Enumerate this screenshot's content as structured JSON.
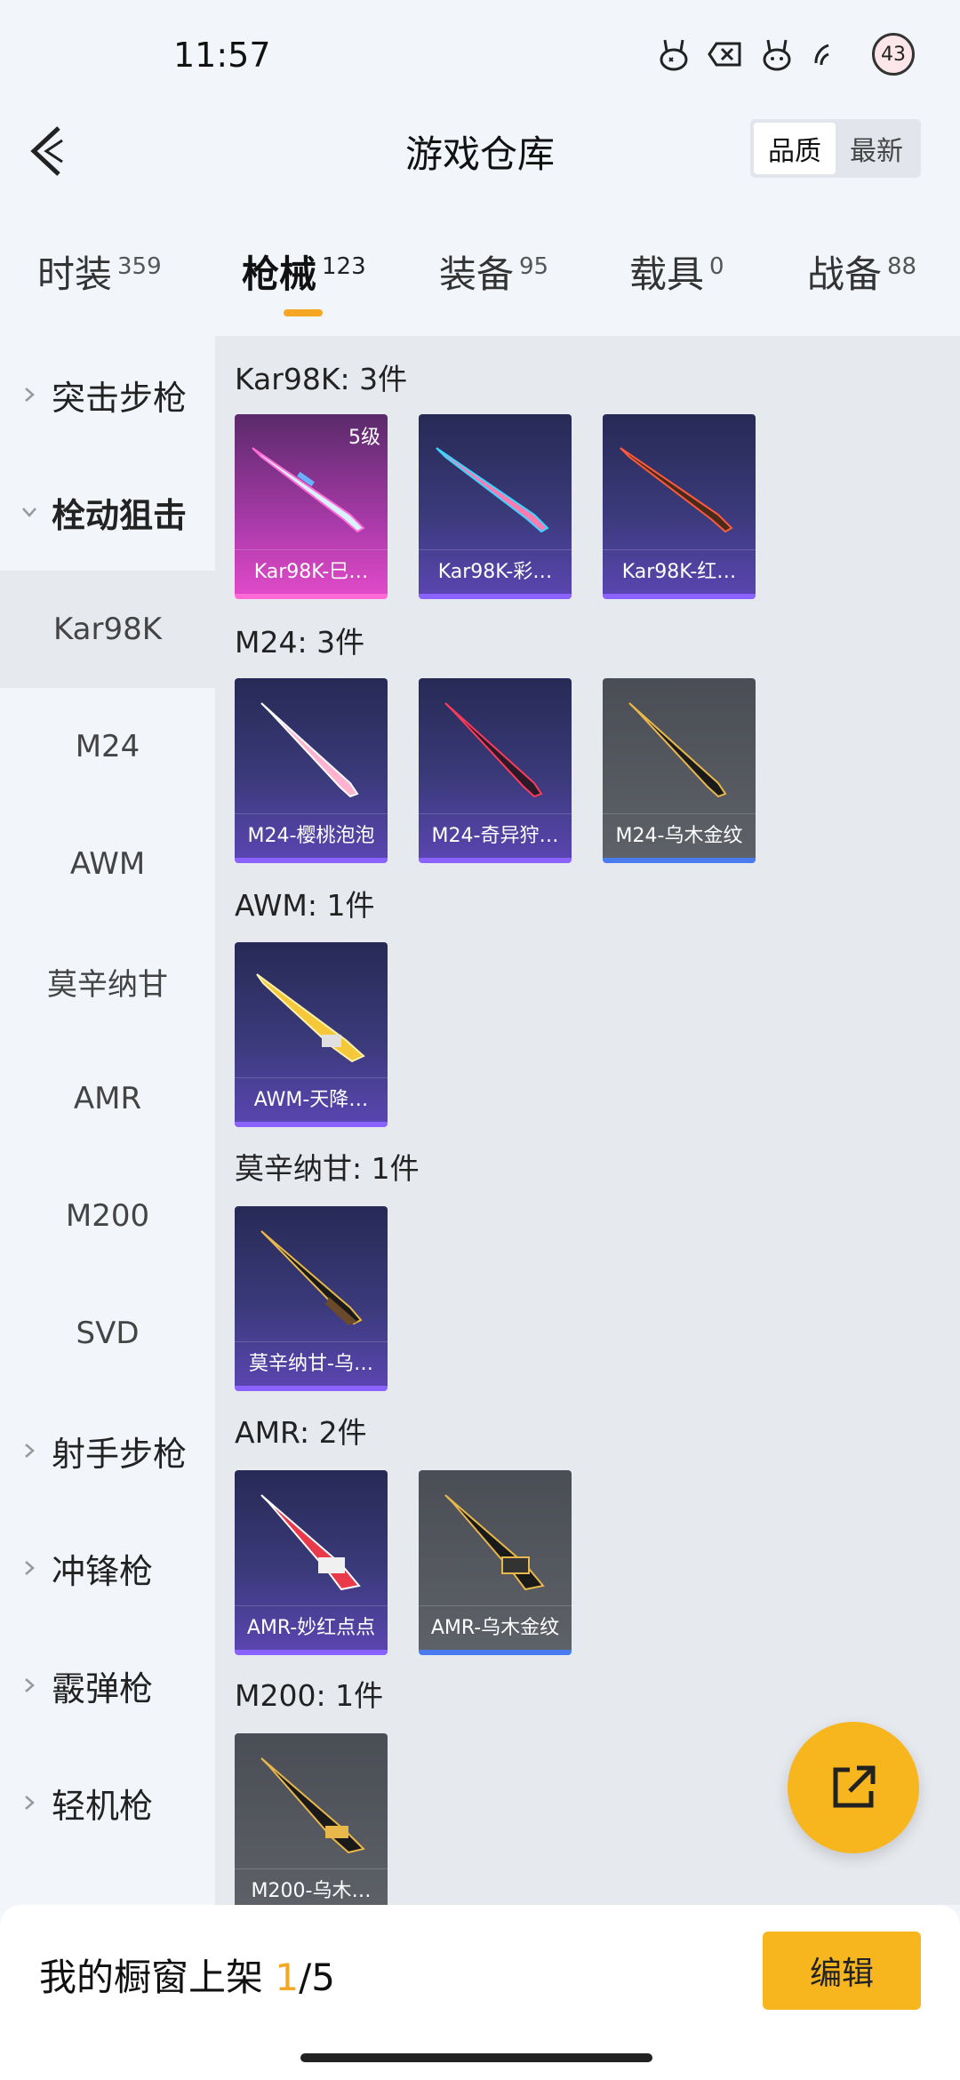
{
  "status_bar": {
    "time": "11:57",
    "notification_count": "43",
    "icons": [
      "rabbit-icon",
      "close-box-icon",
      "rabbit-icon",
      "wifi-icon",
      "avatar-wings-icon"
    ]
  },
  "header": {
    "title": "游戏仓库",
    "sort_options": [
      "品质",
      "最新"
    ],
    "sort_selected": "品质"
  },
  "tabs": [
    {
      "label": "时装",
      "count": "359"
    },
    {
      "label": "枪械",
      "count": "123",
      "active": true
    },
    {
      "label": "装备",
      "count": "95"
    },
    {
      "label": "载具",
      "count": "0"
    },
    {
      "label": "战备",
      "count": "88"
    }
  ],
  "sidebar": [
    {
      "label": "突击步枪",
      "type": "group"
    },
    {
      "label": "栓动狙击",
      "type": "group",
      "expanded": true
    },
    {
      "label": "Kar98K",
      "type": "sub",
      "active": true
    },
    {
      "label": "M24",
      "type": "sub"
    },
    {
      "label": "AWM",
      "type": "sub"
    },
    {
      "label": "莫辛纳甘",
      "type": "sub"
    },
    {
      "label": "AMR",
      "type": "sub"
    },
    {
      "label": "M200",
      "type": "sub"
    },
    {
      "label": "SVD",
      "type": "sub"
    },
    {
      "label": "射手步枪",
      "type": "group"
    },
    {
      "label": "冲锋枪",
      "type": "group"
    },
    {
      "label": "霰弹枪",
      "type": "group"
    },
    {
      "label": "轻机枪",
      "type": "group"
    }
  ],
  "groups": [
    {
      "title": "Kar98K: 3件",
      "items": [
        {
          "name": "Kar98K-巳…",
          "rarity": "pink",
          "level": "5级"
        },
        {
          "name": "Kar98K-彩…",
          "rarity": "purple"
        },
        {
          "name": "Kar98K-红…",
          "rarity": "purple"
        }
      ]
    },
    {
      "title": "M24: 3件",
      "items": [
        {
          "name": "M24-樱桃泡泡",
          "rarity": "purple"
        },
        {
          "name": "M24-奇异狩…",
          "rarity": "purple"
        },
        {
          "name": "M24-乌木金纹",
          "rarity": "gray"
        }
      ]
    },
    {
      "title": "AWM: 1件",
      "items": [
        {
          "name": "AWM-天降…",
          "rarity": "purple"
        }
      ]
    },
    {
      "title": "莫辛纳甘: 1件",
      "items": [
        {
          "name": "莫辛纳甘-乌…",
          "rarity": "purple"
        }
      ]
    },
    {
      "title": "AMR: 2件",
      "items": [
        {
          "name": "AMR-妙红点点",
          "rarity": "purple"
        },
        {
          "name": "AMR-乌木金纹",
          "rarity": "gray"
        }
      ]
    },
    {
      "title": "M200: 1件",
      "items": [
        {
          "name": "M200-乌木…",
          "rarity": "gray"
        }
      ]
    }
  ],
  "bottom": {
    "shelf_prefix": "我的橱窗上架 ",
    "shelf_current": "1",
    "shelf_total": "/5",
    "edit_label": "编辑"
  },
  "colors": {
    "accent": "#f7b51e",
    "pink_rarity": "#e04ac8",
    "purple_rarity": "#5a45b0",
    "gray_rarity": "#5e6168"
  }
}
